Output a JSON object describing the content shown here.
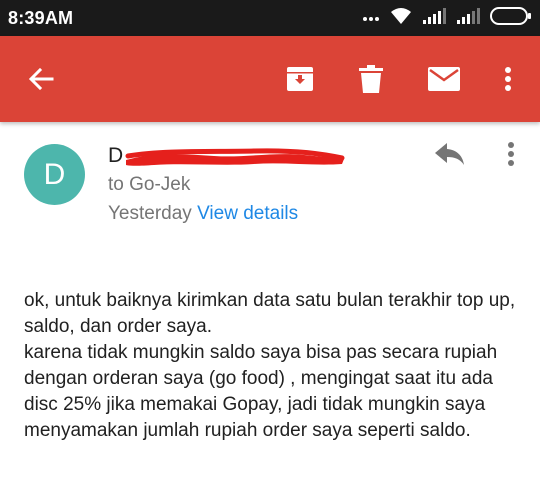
{
  "status_bar": {
    "time": "8:39AM",
    "icons": [
      "dots-icon",
      "wifi-icon",
      "signal-icon",
      "signal-icon",
      "battery-icon"
    ]
  },
  "toolbar": {
    "color": "#db4437",
    "actions": [
      "back-arrow-icon",
      "archive-icon",
      "delete-icon",
      "mail-icon",
      "more-vert-icon"
    ]
  },
  "message": {
    "avatar_letter": "D",
    "avatar_color": "#4db6ac",
    "sender_initial": "D",
    "recipient": "to Go-Jek",
    "date": "Yesterday",
    "view_details": "View details",
    "link_color": "#1e88e5",
    "body": [
      "ok,  untuk baiknya kirimkan data satu bulan terakhir top up,  saldo,  dan order saya.",
      "karena tidak mungkin saldo saya bisa pas secara rupiah dengan orderan saya (go food) ,  mengingat saat itu ada disc 25% jika memakai Gopay, jadi tidak mungkin saya menyamakan jumlah rupiah order saya seperti saldo."
    ]
  }
}
